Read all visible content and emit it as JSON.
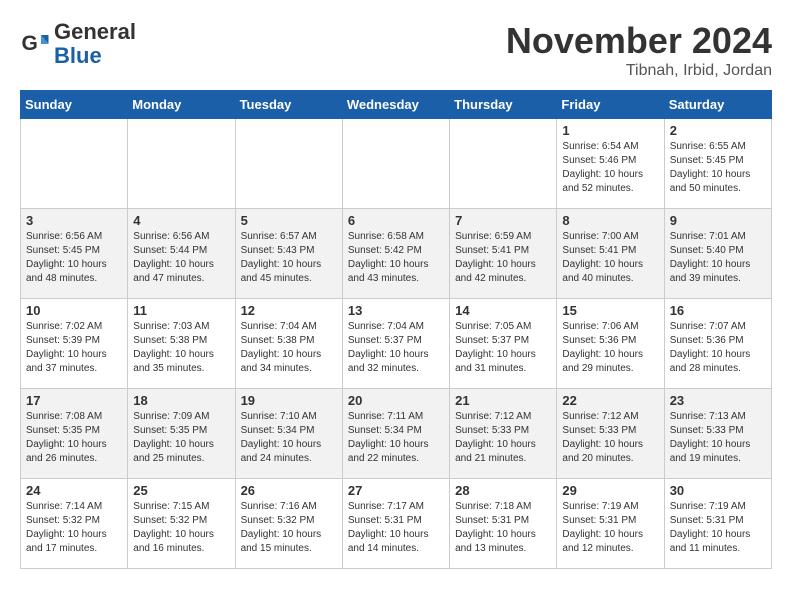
{
  "header": {
    "logo_line1": "General",
    "logo_line2": "Blue",
    "month": "November 2024",
    "location": "Tibnah, Irbid, Jordan"
  },
  "weekdays": [
    "Sunday",
    "Monday",
    "Tuesday",
    "Wednesday",
    "Thursday",
    "Friday",
    "Saturday"
  ],
  "weeks": [
    [
      {
        "day": "",
        "info": ""
      },
      {
        "day": "",
        "info": ""
      },
      {
        "day": "",
        "info": ""
      },
      {
        "day": "",
        "info": ""
      },
      {
        "day": "",
        "info": ""
      },
      {
        "day": "1",
        "info": "Sunrise: 6:54 AM\nSunset: 5:46 PM\nDaylight: 10 hours\nand 52 minutes."
      },
      {
        "day": "2",
        "info": "Sunrise: 6:55 AM\nSunset: 5:45 PM\nDaylight: 10 hours\nand 50 minutes."
      }
    ],
    [
      {
        "day": "3",
        "info": "Sunrise: 6:56 AM\nSunset: 5:45 PM\nDaylight: 10 hours\nand 48 minutes."
      },
      {
        "day": "4",
        "info": "Sunrise: 6:56 AM\nSunset: 5:44 PM\nDaylight: 10 hours\nand 47 minutes."
      },
      {
        "day": "5",
        "info": "Sunrise: 6:57 AM\nSunset: 5:43 PM\nDaylight: 10 hours\nand 45 minutes."
      },
      {
        "day": "6",
        "info": "Sunrise: 6:58 AM\nSunset: 5:42 PM\nDaylight: 10 hours\nand 43 minutes."
      },
      {
        "day": "7",
        "info": "Sunrise: 6:59 AM\nSunset: 5:41 PM\nDaylight: 10 hours\nand 42 minutes."
      },
      {
        "day": "8",
        "info": "Sunrise: 7:00 AM\nSunset: 5:41 PM\nDaylight: 10 hours\nand 40 minutes."
      },
      {
        "day": "9",
        "info": "Sunrise: 7:01 AM\nSunset: 5:40 PM\nDaylight: 10 hours\nand 39 minutes."
      }
    ],
    [
      {
        "day": "10",
        "info": "Sunrise: 7:02 AM\nSunset: 5:39 PM\nDaylight: 10 hours\nand 37 minutes."
      },
      {
        "day": "11",
        "info": "Sunrise: 7:03 AM\nSunset: 5:38 PM\nDaylight: 10 hours\nand 35 minutes."
      },
      {
        "day": "12",
        "info": "Sunrise: 7:04 AM\nSunset: 5:38 PM\nDaylight: 10 hours\nand 34 minutes."
      },
      {
        "day": "13",
        "info": "Sunrise: 7:04 AM\nSunset: 5:37 PM\nDaylight: 10 hours\nand 32 minutes."
      },
      {
        "day": "14",
        "info": "Sunrise: 7:05 AM\nSunset: 5:37 PM\nDaylight: 10 hours\nand 31 minutes."
      },
      {
        "day": "15",
        "info": "Sunrise: 7:06 AM\nSunset: 5:36 PM\nDaylight: 10 hours\nand 29 minutes."
      },
      {
        "day": "16",
        "info": "Sunrise: 7:07 AM\nSunset: 5:36 PM\nDaylight: 10 hours\nand 28 minutes."
      }
    ],
    [
      {
        "day": "17",
        "info": "Sunrise: 7:08 AM\nSunset: 5:35 PM\nDaylight: 10 hours\nand 26 minutes."
      },
      {
        "day": "18",
        "info": "Sunrise: 7:09 AM\nSunset: 5:35 PM\nDaylight: 10 hours\nand 25 minutes."
      },
      {
        "day": "19",
        "info": "Sunrise: 7:10 AM\nSunset: 5:34 PM\nDaylight: 10 hours\nand 24 minutes."
      },
      {
        "day": "20",
        "info": "Sunrise: 7:11 AM\nSunset: 5:34 PM\nDaylight: 10 hours\nand 22 minutes."
      },
      {
        "day": "21",
        "info": "Sunrise: 7:12 AM\nSunset: 5:33 PM\nDaylight: 10 hours\nand 21 minutes."
      },
      {
        "day": "22",
        "info": "Sunrise: 7:12 AM\nSunset: 5:33 PM\nDaylight: 10 hours\nand 20 minutes."
      },
      {
        "day": "23",
        "info": "Sunrise: 7:13 AM\nSunset: 5:33 PM\nDaylight: 10 hours\nand 19 minutes."
      }
    ],
    [
      {
        "day": "24",
        "info": "Sunrise: 7:14 AM\nSunset: 5:32 PM\nDaylight: 10 hours\nand 17 minutes."
      },
      {
        "day": "25",
        "info": "Sunrise: 7:15 AM\nSunset: 5:32 PM\nDaylight: 10 hours\nand 16 minutes."
      },
      {
        "day": "26",
        "info": "Sunrise: 7:16 AM\nSunset: 5:32 PM\nDaylight: 10 hours\nand 15 minutes."
      },
      {
        "day": "27",
        "info": "Sunrise: 7:17 AM\nSunset: 5:31 PM\nDaylight: 10 hours\nand 14 minutes."
      },
      {
        "day": "28",
        "info": "Sunrise: 7:18 AM\nSunset: 5:31 PM\nDaylight: 10 hours\nand 13 minutes."
      },
      {
        "day": "29",
        "info": "Sunrise: 7:19 AM\nSunset: 5:31 PM\nDaylight: 10 hours\nand 12 minutes."
      },
      {
        "day": "30",
        "info": "Sunrise: 7:19 AM\nSunset: 5:31 PM\nDaylight: 10 hours\nand 11 minutes."
      }
    ]
  ]
}
